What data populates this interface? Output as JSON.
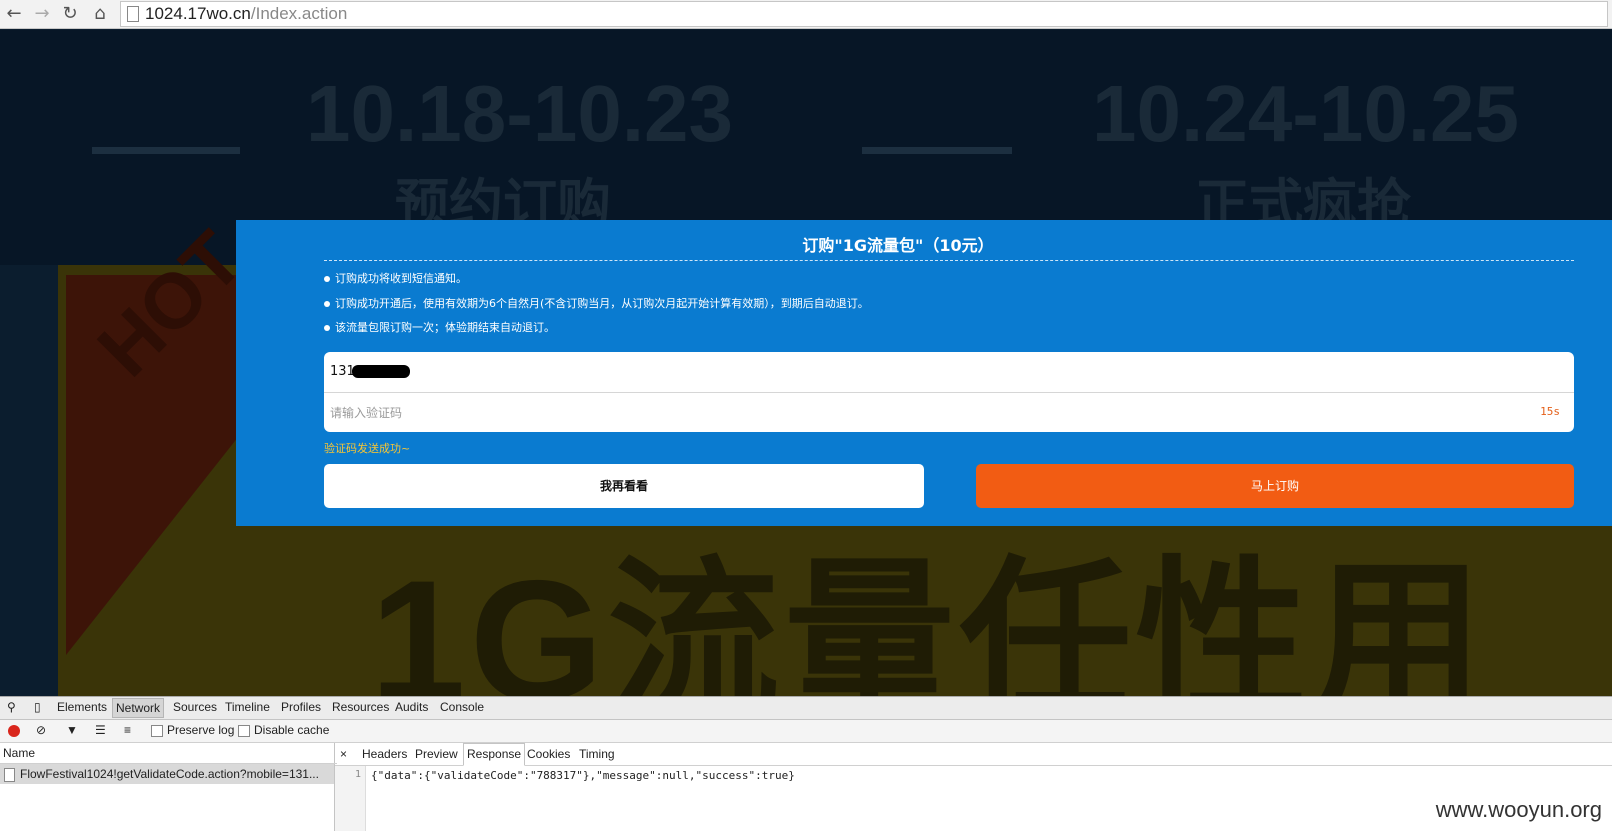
{
  "browser": {
    "url_host": "1024.17wo.cn",
    "url_path": "/Index.action",
    "back_icon": "←",
    "forward_icon": "→",
    "reload_icon": "↻",
    "home_icon": "⌂"
  },
  "background": {
    "date_left": "10.18-10.23",
    "phase_left": "预约订购",
    "date_right": "10.24-10.25",
    "phase_right": "正式疯抢",
    "hot_label": "HOT",
    "headline": "1G流量任性用"
  },
  "modal": {
    "title": "订购\"1G流量包\"（10元）",
    "notices": [
      "订购成功将收到短信通知。",
      "订购成功开通后，使用有效期为6个自然月(不含订购当月，从订购次月起开始计算有效期），到期后自动退订。",
      "该流量包限订购一次；体验期结束自动退订。"
    ],
    "phone_prefix": "131",
    "code_placeholder": "请输入验证码",
    "countdown": "15s",
    "sent_message": "验证码发送成功~",
    "cancel_label": "我再看看",
    "order_label": "马上订购",
    "colors": {
      "panel": "#0a7bd0",
      "order_button": "#f25c13",
      "sent_text": "#f8c534"
    }
  },
  "devtools": {
    "tabs": [
      "Elements",
      "Network",
      "Sources",
      "Timeline",
      "Profiles",
      "Resources",
      "Audits",
      "Console"
    ],
    "active_tab": "Network",
    "preserve_log_label": "Preserve log",
    "disable_cache_label": "Disable cache",
    "name_header": "Name",
    "request_name": "FlowFestival1024!getValidateCode.action?mobile=131...",
    "close_icon": "×",
    "detail_tabs": [
      "Headers",
      "Preview",
      "Response",
      "Cookies",
      "Timing"
    ],
    "active_detail_tab": "Response",
    "line_number": "1",
    "response_body": "{\"data\":{\"validateCode\":\"788317\"},\"message\":null,\"success\":true}"
  },
  "watermark": "www.wooyun.org"
}
